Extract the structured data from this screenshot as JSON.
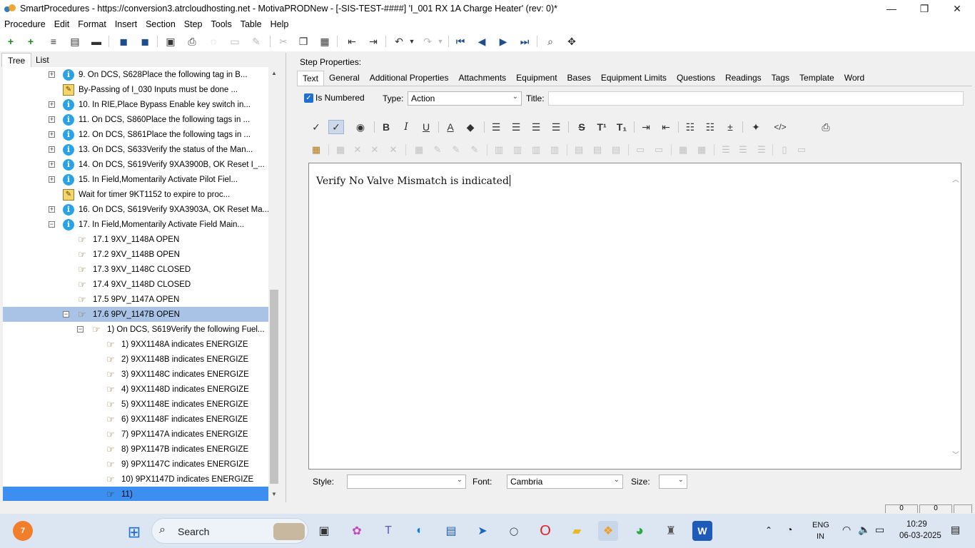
{
  "window": {
    "title": "SmartProcedures - https://conversion3.atrcloudhosting.net - MotivaPRODNew - [-SIS-TEST-####] 'I_001 RX 1A Charge Heater' (rev: 0)*",
    "controls": [
      "—",
      "❐",
      "✕"
    ]
  },
  "menu": [
    "Procedure",
    "Edit",
    "Format",
    "Insert",
    "Section",
    "Step",
    "Tools",
    "Table",
    "Help"
  ],
  "left_tabs": [
    "Tree",
    "List"
  ],
  "tree": [
    {
      "label": "9. On DCS, S628Place the following tag in B...",
      "icon": "info-icon",
      "expand": "+"
    },
    {
      "label": "By-Passing of I_030 Inputs must be done ...",
      "icon": "note-icon",
      "expand": ""
    },
    {
      "label": "10. In RIE,Place Bypass Enable key switch in...",
      "icon": "info-icon",
      "expand": "+"
    },
    {
      "label": "11. On DCS, S860Place the following tags in ...",
      "icon": "info-icon",
      "expand": "+"
    },
    {
      "label": "12. On DCS, S861Place the following tags in ...",
      "icon": "info-icon",
      "expand": "+"
    },
    {
      "label": "13. On DCS, S633Verify the status of the Man...",
      "icon": "info-icon",
      "expand": "+"
    },
    {
      "label": "14. On DCS, S619Verify 9XA3900B, OK Reset I_...",
      "icon": "info-icon",
      "expand": "+"
    },
    {
      "label": "15. In Field,Momentarily Activate Pilot Fiel...",
      "icon": "info-icon",
      "expand": "+"
    },
    {
      "label": "Wait for timer 9KT1152 to expire to proc...",
      "icon": "note-icon",
      "expand": ""
    },
    {
      "label": "16. On DCS, S619Verify 9XA3903A, OK Reset Ma...",
      "icon": "info-icon",
      "expand": "+"
    },
    {
      "label": "17. In Field,Momentarily Activate Field Main...",
      "icon": "info-icon",
      "expand": "−"
    },
    {
      "label": "17.1 9XV_1148A OPEN",
      "icon": "hand-icon",
      "expand": ""
    },
    {
      "label": "17.2 9XV_1148B OPEN",
      "icon": "hand-icon",
      "expand": ""
    },
    {
      "label": "17.3 9XV_1148C CLOSED",
      "icon": "hand-icon",
      "expand": ""
    },
    {
      "label": "17.4 9XV_1148D CLOSED",
      "icon": "hand-icon",
      "expand": ""
    },
    {
      "label": "17.5 9PV_1147A OPEN",
      "icon": "hand-icon",
      "expand": ""
    },
    {
      "label": "17.6 9PV_1147B OPEN",
      "icon": "hand-icon",
      "expand": "−"
    },
    {
      "label": "1) On DCS, S619Verify the following Fuel...",
      "icon": "hand-icon",
      "expand": "−"
    },
    {
      "label": "1) 9XX1148A indicates ENERGIZE",
      "icon": "hand-icon",
      "expand": ""
    },
    {
      "label": "2) 9XX1148B indicates ENERGIZE",
      "icon": "hand-icon",
      "expand": ""
    },
    {
      "label": "3) 9XX1148C indicates ENERGIZE",
      "icon": "hand-icon",
      "expand": ""
    },
    {
      "label": "4) 9XX1148D indicates ENERGIZE",
      "icon": "hand-icon",
      "expand": ""
    },
    {
      "label": "5) 9XX1148E indicates ENERGIZE",
      "icon": "hand-icon",
      "expand": ""
    },
    {
      "label": "6) 9XX1148F indicates ENERGIZE",
      "icon": "hand-icon",
      "expand": ""
    },
    {
      "label": "7) 9PX1147A indicates ENERGIZE",
      "icon": "hand-icon",
      "expand": ""
    },
    {
      "label": "8) 9PX1147B indicates ENERGIZE",
      "icon": "hand-icon",
      "expand": ""
    },
    {
      "label": "9) 9PX1147C indicates ENERGIZE",
      "icon": "hand-icon",
      "expand": ""
    },
    {
      "label": "10) 9PX1147D indicates ENERGIZE",
      "icon": "hand-icon",
      "expand": ""
    },
    {
      "label": "11)",
      "icon": "hand-icon",
      "expand": ""
    }
  ],
  "step_properties": {
    "label": "Step Properties:",
    "tabs": [
      "Text",
      "General",
      "Additional Properties",
      "Attachments",
      "Equipment",
      "Bases",
      "Equipment Limits",
      "Questions",
      "Readings",
      "Tags",
      "Template",
      "Word"
    ],
    "is_numbered_label": "Is Numbered",
    "type_label": "Type:",
    "type_value": "Action",
    "title_label": "Title:",
    "title_value": ""
  },
  "editor": {
    "text": "Verify No Valve Mismatch is indicated"
  },
  "bottom": {
    "style_label": "Style:",
    "style_value": "",
    "font_label": "Font:",
    "font_value": "Cambria",
    "size_label": "Size:",
    "size_value": ""
  },
  "statusbar": [
    "0",
    "0"
  ],
  "taskbar": {
    "badge": "7",
    "search_placeholder": "Search",
    "lang_line1": "ENG",
    "lang_line2": "IN",
    "time": "10:29",
    "date": "06-03-2025"
  },
  "colors": {
    "selection_light": "#a9c3e6",
    "selection_active": "#3c8ef0",
    "info_icon": "#2aa3e6",
    "taskbar": "#dce6f2"
  }
}
